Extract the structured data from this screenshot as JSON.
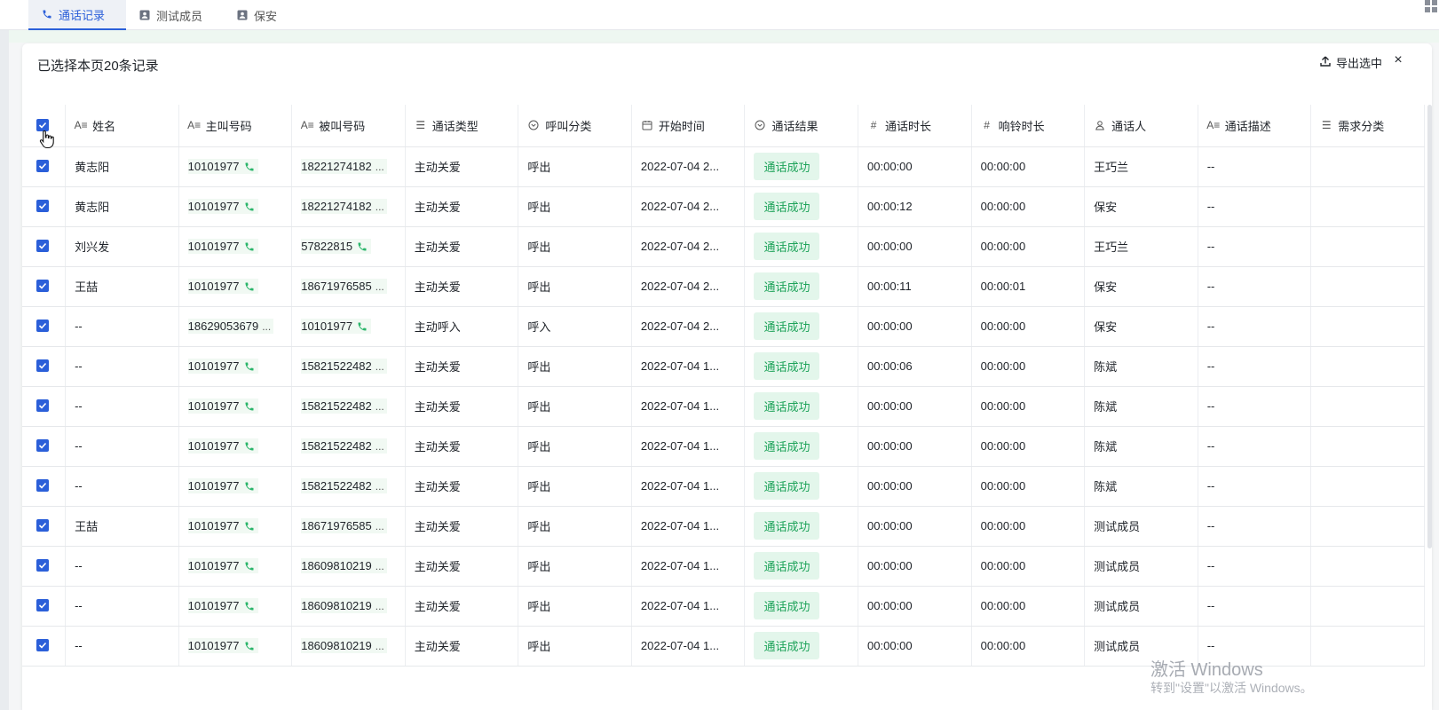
{
  "tabs": [
    {
      "label": "通话记录",
      "icon": "phone-icon",
      "active": true
    },
    {
      "label": "测试成员",
      "icon": "contact-card-icon",
      "active": false
    },
    {
      "label": "保安",
      "icon": "contact-card-icon",
      "active": false
    }
  ],
  "toolbar": {
    "selected_info": "已选择本页20条记录",
    "export_label": "导出选中",
    "close_symbol": "×"
  },
  "table": {
    "columns": [
      {
        "label": "姓名",
        "icon": "text-field-icon",
        "glyph": "A≡"
      },
      {
        "label": "主叫号码",
        "icon": "text-field-icon",
        "glyph": "A≡"
      },
      {
        "label": "被叫号码",
        "icon": "text-field-icon",
        "glyph": "A≡"
      },
      {
        "label": "通话类型",
        "icon": "list-icon",
        "glyph": "☰"
      },
      {
        "label": "呼叫分类",
        "icon": "dropdown-circle-icon",
        "glyph": "⌄"
      },
      {
        "label": "开始时间",
        "icon": "calendar-icon",
        "glyph": "▦"
      },
      {
        "label": "通话结果",
        "icon": "dropdown-circle-icon",
        "glyph": "⌄"
      },
      {
        "label": "通话时长",
        "icon": "number-icon",
        "glyph": "#"
      },
      {
        "label": "响铃时长",
        "icon": "number-icon",
        "glyph": "#"
      },
      {
        "label": "通话人",
        "icon": "person-icon",
        "glyph": "♙"
      },
      {
        "label": "通话描述",
        "icon": "text-field-icon",
        "glyph": "A≡"
      },
      {
        "label": "需求分类",
        "icon": "list-icon",
        "glyph": "☰"
      }
    ],
    "rows": [
      {
        "name": "黄志阳",
        "caller": "10101977",
        "caller_more": false,
        "callee": "18221274182",
        "callee_more": true,
        "type": "主动关爱",
        "category": "呼出",
        "start": "2022-07-04 2...",
        "result": "通话成功",
        "duration": "00:00:00",
        "ring": "00:00:00",
        "person": "王巧兰",
        "desc": "--"
      },
      {
        "name": "黄志阳",
        "caller": "10101977",
        "caller_more": false,
        "callee": "18221274182",
        "callee_more": true,
        "type": "主动关爱",
        "category": "呼出",
        "start": "2022-07-04 2...",
        "result": "通话成功",
        "duration": "00:00:12",
        "ring": "00:00:00",
        "person": "保安",
        "desc": "--"
      },
      {
        "name": "刘兴发",
        "caller": "10101977",
        "caller_more": false,
        "callee": "57822815",
        "callee_more": false,
        "type": "主动关爱",
        "category": "呼出",
        "start": "2022-07-04 2...",
        "result": "通话成功",
        "duration": "00:00:00",
        "ring": "00:00:00",
        "person": "王巧兰",
        "desc": "--"
      },
      {
        "name": "王喆",
        "caller": "10101977",
        "caller_more": false,
        "callee": "18671976585",
        "callee_more": true,
        "type": "主动关爱",
        "category": "呼出",
        "start": "2022-07-04 2...",
        "result": "通话成功",
        "duration": "00:00:11",
        "ring": "00:00:01",
        "person": "保安",
        "desc": "--"
      },
      {
        "name": "--",
        "caller": "18629053679",
        "caller_more": true,
        "callee": "10101977",
        "callee_more": false,
        "type": "主动呼入",
        "category": "呼入",
        "start": "2022-07-04 2...",
        "result": "通话成功",
        "duration": "00:00:00",
        "ring": "00:00:00",
        "person": "保安",
        "desc": "--"
      },
      {
        "name": "--",
        "caller": "10101977",
        "caller_more": false,
        "callee": "15821522482",
        "callee_more": true,
        "type": "主动关爱",
        "category": "呼出",
        "start": "2022-07-04 1...",
        "result": "通话成功",
        "duration": "00:00:06",
        "ring": "00:00:00",
        "person": "陈斌",
        "desc": "--"
      },
      {
        "name": "--",
        "caller": "10101977",
        "caller_more": false,
        "callee": "15821522482",
        "callee_more": true,
        "type": "主动关爱",
        "category": "呼出",
        "start": "2022-07-04 1...",
        "result": "通话成功",
        "duration": "00:00:00",
        "ring": "00:00:00",
        "person": "陈斌",
        "desc": "--"
      },
      {
        "name": "--",
        "caller": "10101977",
        "caller_more": false,
        "callee": "15821522482",
        "callee_more": true,
        "type": "主动关爱",
        "category": "呼出",
        "start": "2022-07-04 1...",
        "result": "通话成功",
        "duration": "00:00:00",
        "ring": "00:00:00",
        "person": "陈斌",
        "desc": "--"
      },
      {
        "name": "--",
        "caller": "10101977",
        "caller_more": false,
        "callee": "15821522482",
        "callee_more": true,
        "type": "主动关爱",
        "category": "呼出",
        "start": "2022-07-04 1...",
        "result": "通话成功",
        "duration": "00:00:00",
        "ring": "00:00:00",
        "person": "陈斌",
        "desc": "--"
      },
      {
        "name": "王喆",
        "caller": "10101977",
        "caller_more": false,
        "callee": "18671976585",
        "callee_more": true,
        "type": "主动关爱",
        "category": "呼出",
        "start": "2022-07-04 1...",
        "result": "通话成功",
        "duration": "00:00:00",
        "ring": "00:00:00",
        "person": "测试成员",
        "desc": "--"
      },
      {
        "name": "--",
        "caller": "10101977",
        "caller_more": false,
        "callee": "18609810219",
        "callee_more": true,
        "type": "主动关爱",
        "category": "呼出",
        "start": "2022-07-04 1...",
        "result": "通话成功",
        "duration": "00:00:00",
        "ring": "00:00:00",
        "person": "测试成员",
        "desc": "--"
      },
      {
        "name": "--",
        "caller": "10101977",
        "caller_more": false,
        "callee": "18609810219",
        "callee_more": true,
        "type": "主动关爱",
        "category": "呼出",
        "start": "2022-07-04 1...",
        "result": "通话成功",
        "duration": "00:00:00",
        "ring": "00:00:00",
        "person": "测试成员",
        "desc": "--"
      },
      {
        "name": "--",
        "caller": "10101977",
        "caller_more": false,
        "callee": "18609810219",
        "callee_more": true,
        "type": "主动关爱",
        "category": "呼出",
        "start": "2022-07-04 1...",
        "result": "通话成功",
        "duration": "00:00:00",
        "ring": "00:00:00",
        "person": "测试成员",
        "desc": "--"
      }
    ],
    "more_symbol": "..."
  },
  "watermark": {
    "line1": "激活 Windows",
    "line2": "转到\"设置\"以激活 Windows。"
  },
  "colors": {
    "accent": "#2b5fd9",
    "success_text": "#1ea35a",
    "success_bg": "#e3f6eb",
    "phone_green": "#2ab56a"
  }
}
